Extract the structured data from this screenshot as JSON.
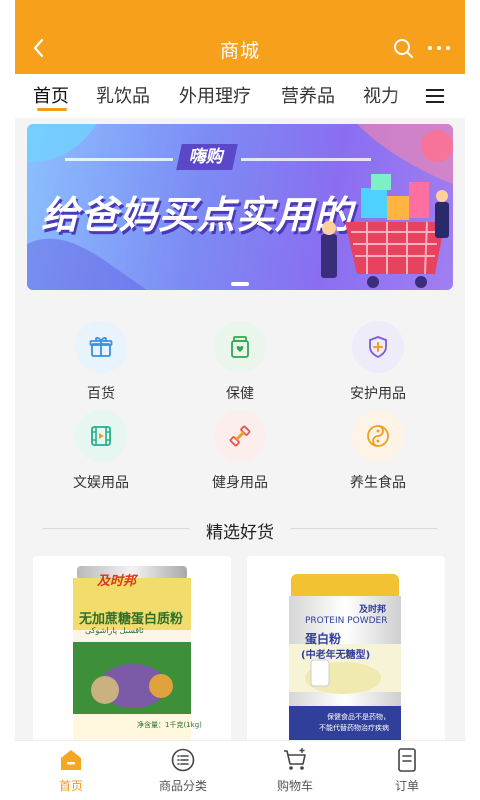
{
  "header": {
    "title": "商城",
    "back_icon": "chevron-left-icon",
    "search_icon": "search-icon",
    "more_icon": "more-dots-icon",
    "bg_color": "#f7a01c"
  },
  "tabs": {
    "items": [
      {
        "label": "首页",
        "active": true
      },
      {
        "label": "乳饮品"
      },
      {
        "label": "外用理疗"
      },
      {
        "label": "营养品"
      },
      {
        "label": "视力"
      }
    ],
    "menu_icon": "menu-icon",
    "accent": "#f39b1b"
  },
  "banner": {
    "tag": "嗨购",
    "headline": "给爸妈买点实用的",
    "indicator_count": 1
  },
  "categories": [
    {
      "label": "百货",
      "icon": "gift-box-icon"
    },
    {
      "label": "保健",
      "icon": "health-jar-icon"
    },
    {
      "label": "安护用品",
      "icon": "shield-plus-icon"
    },
    {
      "label": "文娱用品",
      "icon": "film-icon"
    },
    {
      "label": "健身用品",
      "icon": "dumbbell-icon"
    },
    {
      "label": "养生食品",
      "icon": "taiji-icon"
    }
  ],
  "featured": {
    "title": "精选好货",
    "products": [
      {
        "brand": "及时邦",
        "name": "无加蔗糖蛋白质粉",
        "subtitle": "ئاقسىل پاراشوكى",
        "net_weight": "净含量：1千克(1kg)"
      },
      {
        "brand": "及时邦",
        "brand_en": "PROTEIN POWDER",
        "name": "蛋白粉",
        "variant": "(中老年无糖型)",
        "note_1": "保健食品不是药物，",
        "note_2": "不能代替药物治疗疾病"
      }
    ]
  },
  "bottom_nav": [
    {
      "label": "首页",
      "icon": "home-icon",
      "active": true
    },
    {
      "label": "商品分类",
      "icon": "category-list-icon"
    },
    {
      "label": "购物车",
      "icon": "cart-icon"
    },
    {
      "label": "订单",
      "icon": "order-icon"
    }
  ]
}
